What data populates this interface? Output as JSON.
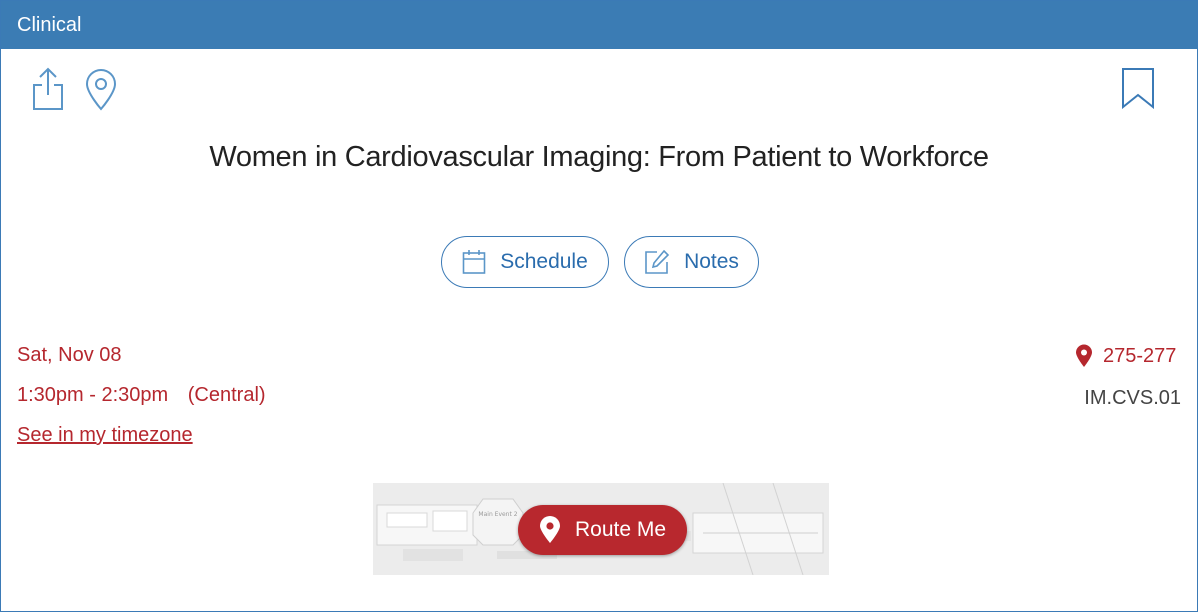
{
  "header": {
    "category": "Clinical"
  },
  "toolbar": {
    "icons": [
      "share-icon",
      "location-pin-icon",
      "bookmark-icon"
    ]
  },
  "session": {
    "title": "Women in Cardiovascular Imaging: From Patient to Workforce",
    "date": "Sat, Nov 08",
    "time": "1:30pm - 2:30pm",
    "timezone": "(Central)",
    "timezone_link": "See in my timezone",
    "room": "275-277",
    "code": "IM.CVS.01"
  },
  "actions": {
    "schedule_label": "Schedule",
    "notes_label": "Notes",
    "route_label": "Route Me"
  },
  "map_labels": {
    "booth": "Main Event 2"
  },
  "colors": {
    "header_blue": "#3b7cb4",
    "accent_blue": "#2a6cad",
    "accent_red": "#b5272e"
  }
}
